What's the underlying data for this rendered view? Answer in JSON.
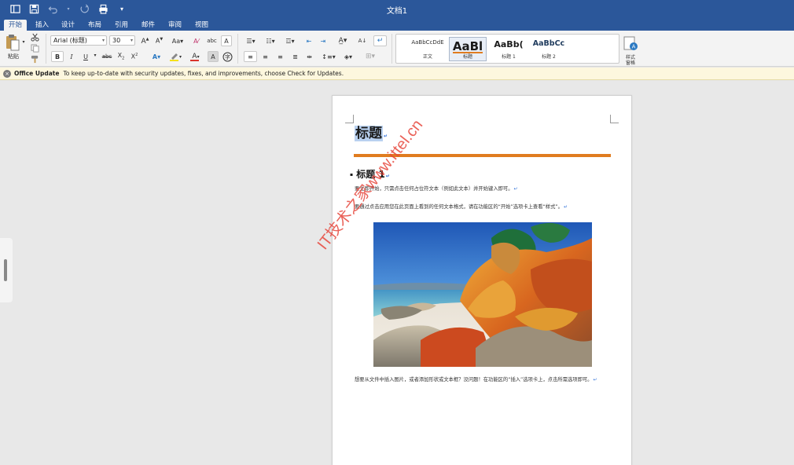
{
  "window": {
    "title": "文档1"
  },
  "quick_access": [
    "sidebar-icon",
    "save-icon",
    "undo-icon",
    "redo-icon",
    "print-icon",
    "customize-icon"
  ],
  "tabs": [
    "开始",
    "插入",
    "设计",
    "布局",
    "引用",
    "邮件",
    "审阅",
    "视图"
  ],
  "ribbon": {
    "paste_label": "粘贴",
    "font_family": "Arial (标题)",
    "font_size": "30",
    "styles": [
      {
        "preview": "AaBbCcDdE",
        "name": "正文"
      },
      {
        "preview": "AaBl",
        "name": "标题"
      },
      {
        "preview": "AaBb(",
        "name": "标题 1"
      },
      {
        "preview": "AaBbCc",
        "name": "标题 2"
      }
    ],
    "styles_pane_label_1": "样式",
    "styles_pane_label_2": "窗格",
    "colors": {
      "highlight": "#f5e11a",
      "font_color": "#d9342b"
    }
  },
  "notification": {
    "title": "Office Update",
    "message": "To keep up-to-date with security updates, fixes, and improvements, choose Check for Updates."
  },
  "document": {
    "title": "标题",
    "heading1": "标题 1",
    "paragraphs": [
      "要立即开始，只需点击任何占位符文本（例如此文本）并开始键入即可。",
      "要通过点击应用您在此页面上看到的任何文本格式，请在功能区的“开始”选项卡上查看“样式”。",
      "想要从文件中插入图片，或者添加形状或文本框？没问题！在功能区的“插入”选项卡上，点击所需选项即可。"
    ],
    "accent_rule_color": "#e07c1f"
  },
  "watermark": "IT技术之家www.ittel.cn"
}
